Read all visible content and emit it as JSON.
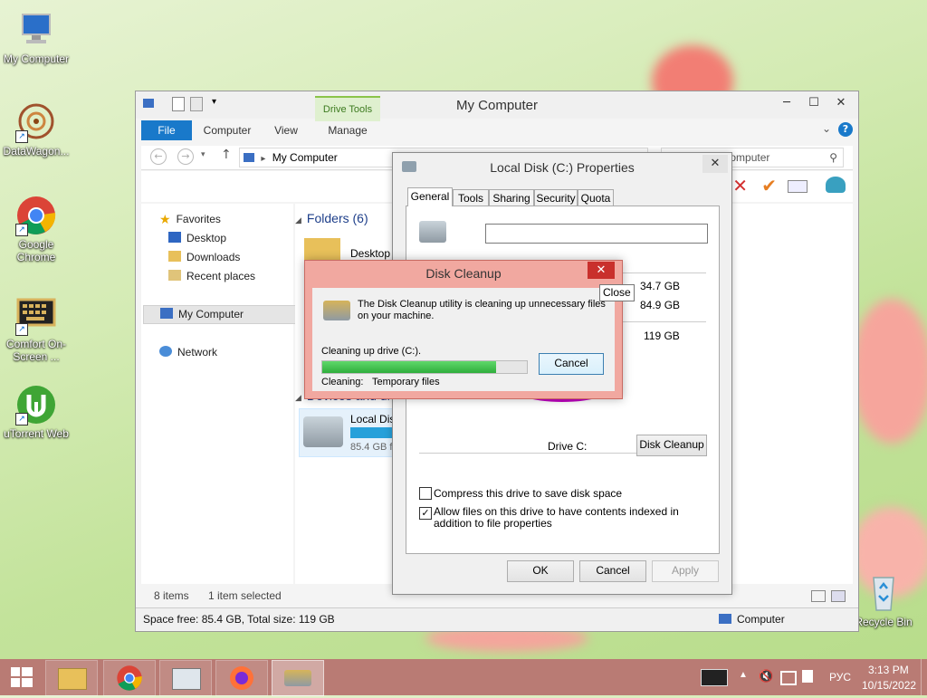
{
  "desktop": {
    "icons": [
      {
        "label": "My Computer"
      },
      {
        "label": "DataWagon..."
      },
      {
        "label": "Google Chrome"
      },
      {
        "label": "Comfort On-Screen ..."
      },
      {
        "label": "uTorrent Web"
      },
      {
        "label": "Recycle Bin"
      }
    ]
  },
  "explorer": {
    "title": "My Computer",
    "context_tab": "Drive Tools",
    "tabs": [
      "File",
      "Computer",
      "View",
      "Manage"
    ],
    "address": "My Computer",
    "search_placeholder": "Search My Computer",
    "nav": {
      "favorites": "Favorites",
      "desktop": "Desktop",
      "downloads": "Downloads",
      "recent": "Recent places",
      "my_computer": "My Computer",
      "network": "Network"
    },
    "content": {
      "folders_header": "Folders (6)",
      "folder_desktop": "Desktop",
      "devices_header": "Devices and drives",
      "drive_name": "Local Disk (C:)",
      "drive_free": "85.4 GB free of 119 GB"
    },
    "status": {
      "items": "8 items",
      "selected": "1 item selected"
    },
    "details": {
      "space": "Space free: 85.4 GB, Total size: 119 GB",
      "location": "Computer"
    }
  },
  "properties": {
    "title": "Local Disk (C:) Properties",
    "tabs": [
      "General",
      "Tools",
      "Sharing",
      "Security",
      "Quota"
    ],
    "name_value": "",
    "used": "34.7 GB",
    "free": "84.9 GB",
    "capacity": "119 GB",
    "drive_label": "Drive C:",
    "disk_cleanup_btn": "Disk Cleanup",
    "compress_label": "Compress this drive to save disk space",
    "compress_checked": false,
    "index_label": "Allow files on this drive to have contents indexed in addition to file properties",
    "index_checked": true,
    "ok": "OK",
    "cancel": "Cancel",
    "apply": "Apply"
  },
  "cleanup": {
    "title": "Disk Cleanup",
    "message": "The Disk Cleanup utility is cleaning up unnecessary files on your machine.",
    "progress_label": "Cleaning up drive  (C:).",
    "progress_percent": 85,
    "cleaning_label": "Cleaning:",
    "cleaning_value": "Temporary files",
    "cancel": "Cancel",
    "close_tooltip": "Close"
  },
  "taskbar": {
    "language": "РУС",
    "time": "3:13 PM",
    "date": "10/15/2022"
  },
  "colors": {
    "accent": "#1979ca",
    "cleanup_frame": "#f1a8a0",
    "close_red": "#c9302c",
    "progress": "#3cbf4a",
    "pie_free": "#e600e6",
    "pie_used": "#1c3fd6",
    "taskbar": "#b97b74"
  }
}
